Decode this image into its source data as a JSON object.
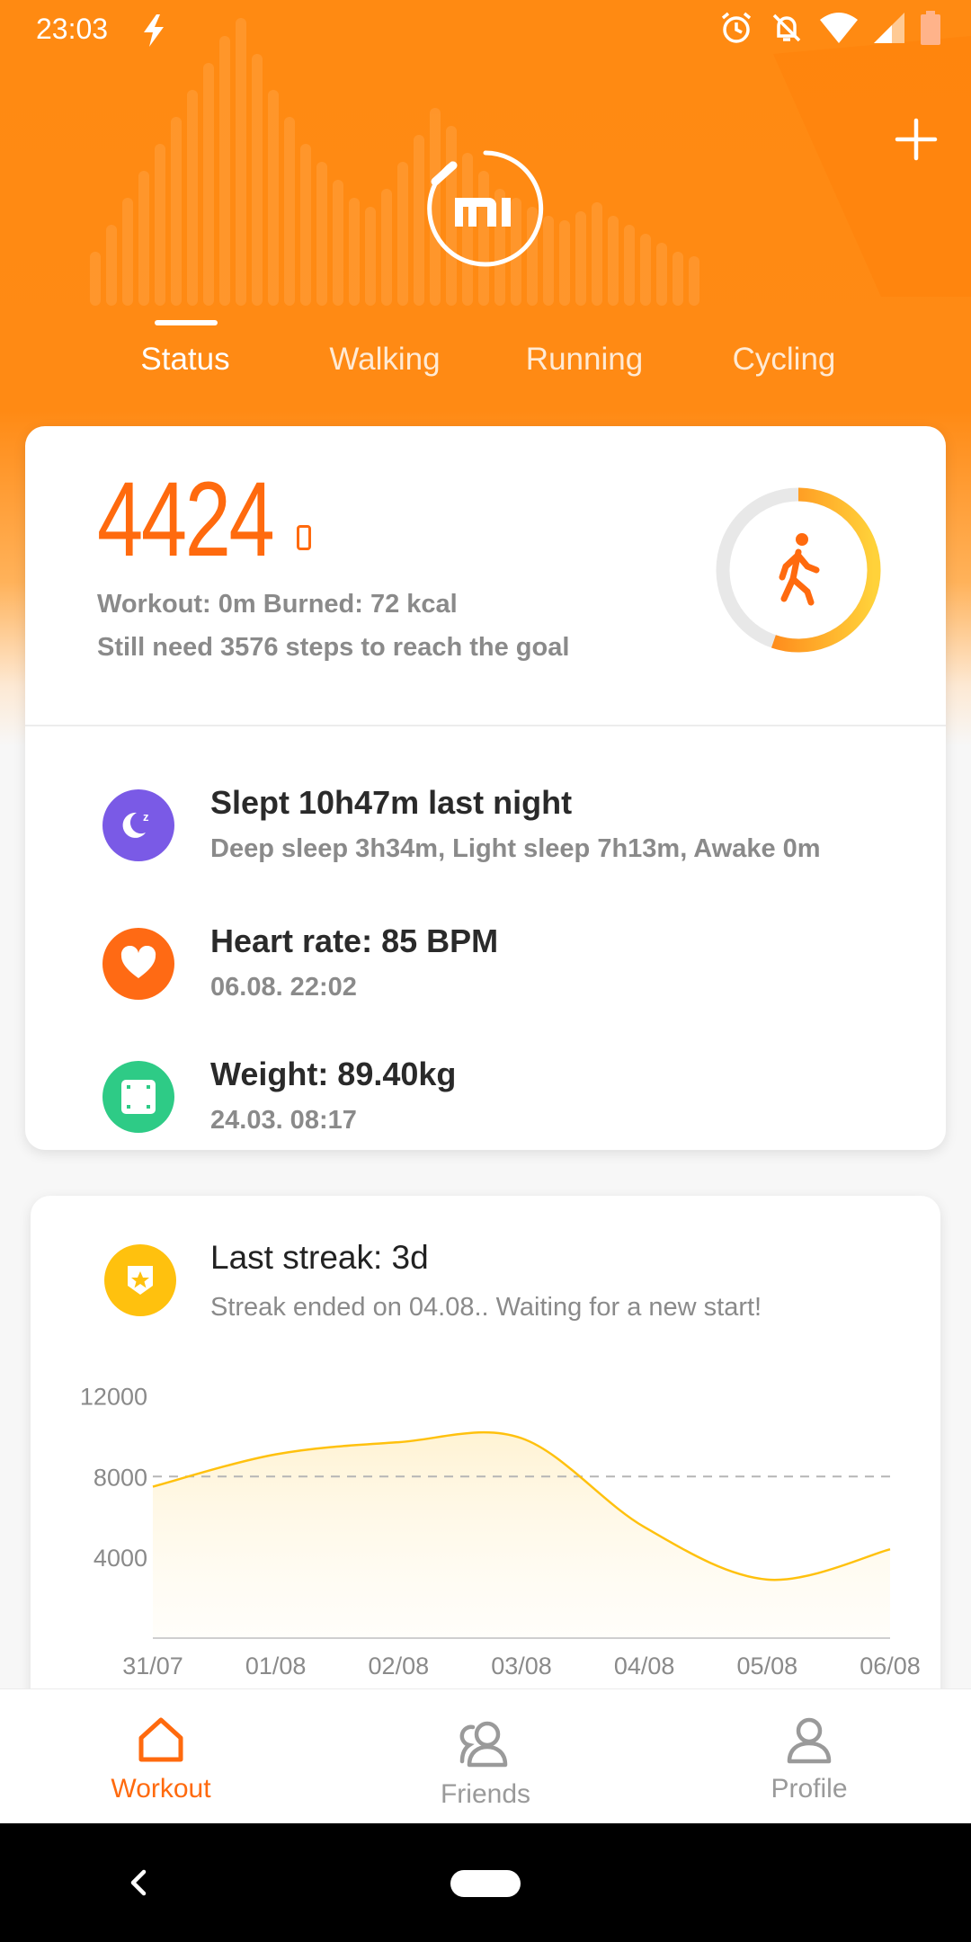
{
  "status_bar": {
    "time": "23:03"
  },
  "tabs": [
    {
      "label": "Status",
      "active": true
    },
    {
      "label": "Walking",
      "active": false
    },
    {
      "label": "Running",
      "active": false
    },
    {
      "label": "Cycling",
      "active": false
    }
  ],
  "activity": {
    "steps": "4424",
    "summary": "Workout: 0m Burned: 72 kcal",
    "goal_text": "Still need 3576 steps to reach the goal",
    "goal_progress": 0.553
  },
  "metrics": {
    "sleep": {
      "title": "Slept 10h47m last night",
      "sub": "Deep sleep 3h34m, Light sleep 7h13m, Awake 0m",
      "color": "#7a5ae6"
    },
    "heart": {
      "title": "Heart rate: 85 BPM",
      "sub": "06.08. 22:02",
      "color": "#ff6a14"
    },
    "weight": {
      "title": "Weight: 89.40kg",
      "sub": "24.03. 08:17",
      "color": "#2ecb86"
    }
  },
  "streak": {
    "title": "Last streak: 3d",
    "sub": "Streak ended on 04.08.. Waiting for a new start!",
    "color": "#ffc10e"
  },
  "chart_data": {
    "type": "line",
    "categories": [
      "31/07",
      "01/08",
      "02/08",
      "03/08",
      "04/08",
      "05/08",
      "06/08"
    ],
    "series": [
      {
        "values": [
          7500,
          9100,
          9700,
          9900,
          5500,
          2900,
          4400
        ]
      }
    ],
    "yticks": [
      "12000",
      "8000",
      "4000"
    ],
    "goal_line": 8000,
    "ylim": [
      0,
      13000
    ],
    "line_color": "#ffc10e"
  },
  "bottom_nav": [
    {
      "label": "Workout",
      "active": true
    },
    {
      "label": "Friends",
      "active": false
    },
    {
      "label": "Profile",
      "active": false
    }
  ],
  "colors": {
    "accent": "#ff6a0e",
    "header": "#ff8a12"
  }
}
